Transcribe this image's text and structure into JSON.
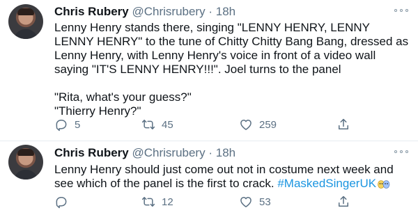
{
  "tweets": [
    {
      "author_name": "Chris Rubery",
      "handle": "@Chrisrubery",
      "separator": "·",
      "time": "18h",
      "text": "Lenny Henry stands there, singing \"LENNY HENRY, LENNY LENNY HENRY\" to the tune of Chitty Chitty Bang Bang, dressed as Lenny Henry, with Lenny Henry's voice in front of a video wall saying \"IT'S LENNY HENRY!!!\". Joel turns to the panel\n\n\"Rita, what's your guess?\"\n\"Thierry Henry?\"",
      "replies": "5",
      "retweets": "45",
      "likes": "259"
    },
    {
      "author_name": "Chris Rubery",
      "handle": "@Chrisrubery",
      "separator": "·",
      "time": "18h",
      "text": "Lenny Henry should just come out not in costume next week and see which of the panel is the first to crack. ",
      "hashtag": "#MaskedSingerUK",
      "replies": "",
      "retweets": "12",
      "likes": "53"
    }
  ],
  "colors": {
    "text": "#0f1419",
    "secondary": "#5b7083",
    "link": "#1b95e0",
    "divider": "#e6ecf0"
  },
  "icons": [
    "reply-icon",
    "retweet-icon",
    "heart-icon",
    "share-icon",
    "more-icon",
    "masks-emoji"
  ]
}
